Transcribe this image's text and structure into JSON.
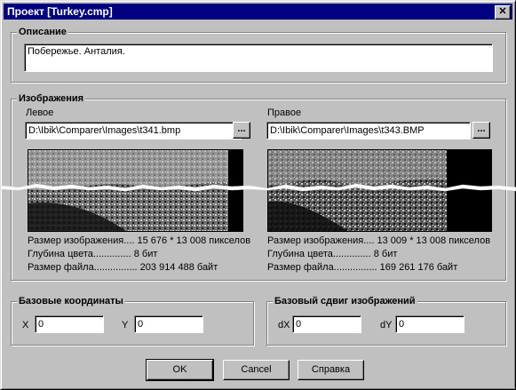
{
  "window": {
    "title": "Проект [Turkey.cmp]",
    "close_glyph": "✕"
  },
  "description": {
    "legend": "Описание",
    "value": "Побережье. Анталия."
  },
  "images": {
    "legend": "Изображения",
    "left": {
      "label": "Левое",
      "path": "D:\\Ibik\\Comparer\\Images\\t341.bmp",
      "browse_label": "...",
      "info": [
        "Размер изображения.... 15 676 * 13 008 пикселов",
        "Глубина цвета.............. 8 бит",
        "Размер файла................ 203 914 488 байт"
      ]
    },
    "right": {
      "label": "Правое",
      "path": "D:\\Ibik\\Comparer\\Images\\t343.BMP",
      "browse_label": "...",
      "info": [
        "Размер изображения.... 13 009 * 13 008 пикселов",
        "Глубина цвета.............. 8 бит",
        "Размер файла................ 169 261 176 байт"
      ]
    }
  },
  "base_coords": {
    "legend": "Базовые координаты",
    "x_label": "X",
    "x_value": "0",
    "y_label": "Y",
    "y_value": "0"
  },
  "base_shift": {
    "legend": "Базовый сдвиг изображений",
    "dx_label": "dX",
    "dx_value": "0",
    "dy_label": "dY",
    "dy_value": "0"
  },
  "buttons": {
    "ok": "OK",
    "cancel": "Cancel",
    "help": "Справка"
  }
}
